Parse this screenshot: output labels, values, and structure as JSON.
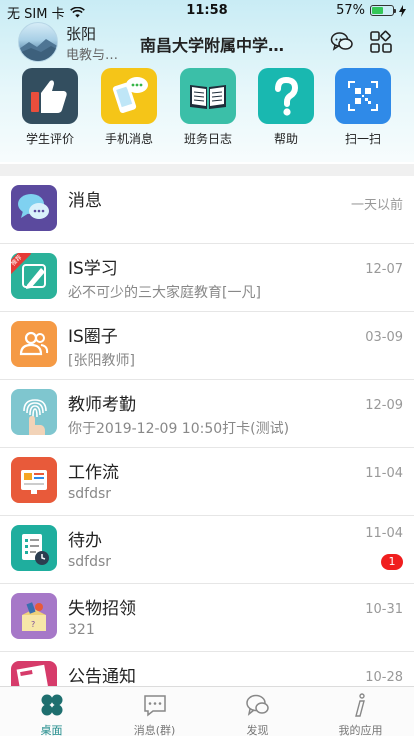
{
  "status_bar": {
    "carrier": "无 SIM 卡",
    "time": "11:58",
    "battery": "57%",
    "battery_level": 0.57
  },
  "user": {
    "name": "张阳",
    "role": "电教与…"
  },
  "school": {
    "name": "南昌大学附属中学…"
  },
  "quick_actions": [
    {
      "label": "学生评价",
      "icon": "thumbs-up-icon",
      "color": "#334e5f"
    },
    {
      "label": "手机消息",
      "icon": "phone-message-icon",
      "color": "#f5c518"
    },
    {
      "label": "班务日志",
      "icon": "book-icon",
      "color": "#3bbfa8"
    },
    {
      "label": "帮助",
      "icon": "help-icon",
      "color": "#19b8b0"
    },
    {
      "label": "扫一扫",
      "icon": "qr-scan-icon",
      "color": "#2f8ae8"
    }
  ],
  "messages": [
    {
      "title": "消息",
      "subtitle": "",
      "time": "一天以前",
      "icon": "chat-bubbles-icon",
      "color": "#5b4a9e"
    },
    {
      "title": "IS学习",
      "subtitle": "必不可少的三大家庭教育[一凡]",
      "time": "12-07",
      "icon": "pencil-icon",
      "color": "#2bb29a",
      "tag": "推荐"
    },
    {
      "title": "IS圈子",
      "subtitle": "[张阳教师]",
      "time": "03-09",
      "icon": "people-icon",
      "color": "#f59a45"
    },
    {
      "title": "教师考勤",
      "subtitle": "你于2019-12-09 10:50打卡(测试)",
      "time": "12-09",
      "icon": "fingerprint-icon",
      "color": "#7fc6cf"
    },
    {
      "title": "工作流",
      "subtitle": "sdfdsr",
      "time": "11-04",
      "icon": "workflow-icon",
      "color": "#e85a3a"
    },
    {
      "title": "待办",
      "subtitle": "sdfdsr",
      "time": "11-04",
      "icon": "todo-icon",
      "color": "#1fae9e",
      "badge": "1"
    },
    {
      "title": "失物招领",
      "subtitle": "321",
      "time": "10-31",
      "icon": "lost-found-icon",
      "color": "#a678c8"
    },
    {
      "title": "公告通知",
      "subtitle": "",
      "time": "10-28",
      "icon": "news-icon",
      "color": "#d63b6a"
    }
  ],
  "tabs": [
    {
      "label": "桌面",
      "icon": "desktop-icon",
      "active": true
    },
    {
      "label": "消息(群)",
      "icon": "message-group-icon",
      "active": false
    },
    {
      "label": "发现",
      "icon": "discover-icon",
      "active": false
    },
    {
      "label": "我的应用",
      "icon": "my-apps-icon",
      "active": false
    }
  ]
}
